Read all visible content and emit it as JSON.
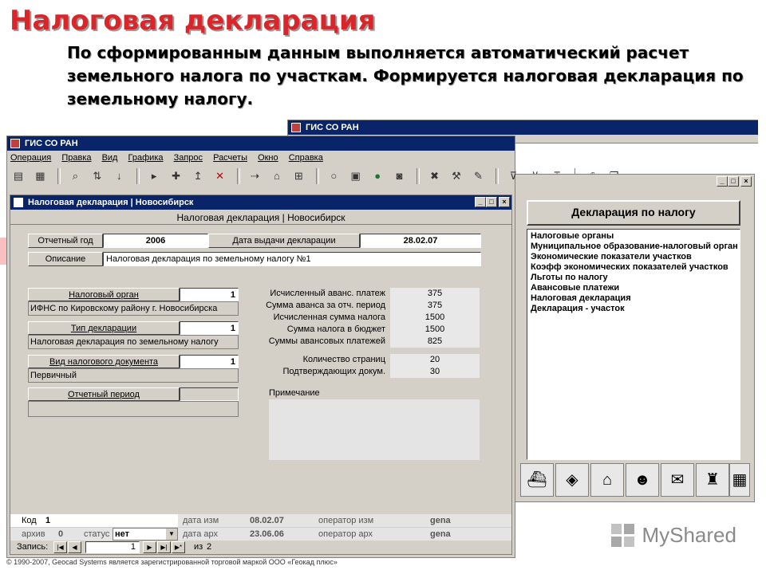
{
  "slide": {
    "title": "Налоговая декларация",
    "subtitle": "По сформированным данным выполняется автоматический расчет земельного налога по участкам. Формируется налоговая декларация по земельному налогу.",
    "footer": "© 1990-2007, Geocad Systems является зарегистрированной торговой маркой ООО «Геокад плюс»",
    "logo": "MyShared"
  },
  "bg_window": {
    "title": "ГИС СО РАН"
  },
  "main_window": {
    "title": "ГИС СО РАН",
    "menu": [
      "Операция",
      "Правка",
      "Вид",
      "Графика",
      "Запрос",
      "Расчеты",
      "Окно",
      "Справка"
    ]
  },
  "right_panel": {
    "button_label": "Декларация по налогу",
    "items": [
      "Налоговые органы",
      "Муниципальное образование-налоговый орган",
      "Экономические показатели участков",
      "Коэфф экономических показателей участков",
      "Льготы по налогу",
      "Авансовые платежи",
      "Налоговая декларация",
      "Декларация - участок"
    ]
  },
  "form": {
    "window_title": "Налоговая декларация | Новосибирск",
    "header": "Налоговая декларация | Новосибирск",
    "year_label": "Отчетный год",
    "year_value": "2006",
    "date_label": "Дата выдачи декларации",
    "date_value": "28.02.07",
    "desc_label": "Описание",
    "desc_value": "Налоговая декларация по земельному налогу №1",
    "tax_office_label": "Налоговый орган",
    "tax_office_num": "1",
    "tax_office_value": "ИФНС по Кировскому району г. Новосибирска",
    "decl_type_label": "Тип декларации",
    "decl_type_num": "1",
    "decl_type_value": "Налоговая декларация по земельному налогу",
    "doc_type_label": "Вид налогового документа",
    "doc_type_num": "1",
    "doc_type_value": "Первичный",
    "period_label": "Отчетный период",
    "period_num": "",
    "period_value": "",
    "calc_rows": [
      {
        "label": "Исчисленный аванс. платеж",
        "value": "375"
      },
      {
        "label": "Сумма аванса за отч. период",
        "value": "375"
      },
      {
        "label": "Исчисленная сумма налога",
        "value": "1500"
      },
      {
        "label": "Сумма налога в бюджет",
        "value": "1500"
      },
      {
        "label": "Суммы авансовых платежей",
        "value": "825"
      }
    ],
    "page_rows": [
      {
        "label": "Количество страниц",
        "value": "20"
      },
      {
        "label": "Подтверждающих докум.",
        "value": "30"
      }
    ],
    "note_label": "Примечание",
    "status1": {
      "code_label": "Код",
      "code_value": "1",
      "date_mod_label": "дата изм",
      "date_mod_value": "08.02.07",
      "op_mod_label": "оператор изм",
      "op_mod_value": "gena"
    },
    "status2": {
      "archive_label": "архив",
      "archive_value": "0",
      "status_label": "статус",
      "status_value": "нет",
      "date_arch_label": "дата арх",
      "date_arch_value": "23.06.06",
      "op_arch_label": "оператор арх",
      "op_arch_value": "gena"
    },
    "nav": {
      "record_label": "Запись:",
      "current": "1",
      "of_label": "из",
      "total": "2"
    }
  }
}
